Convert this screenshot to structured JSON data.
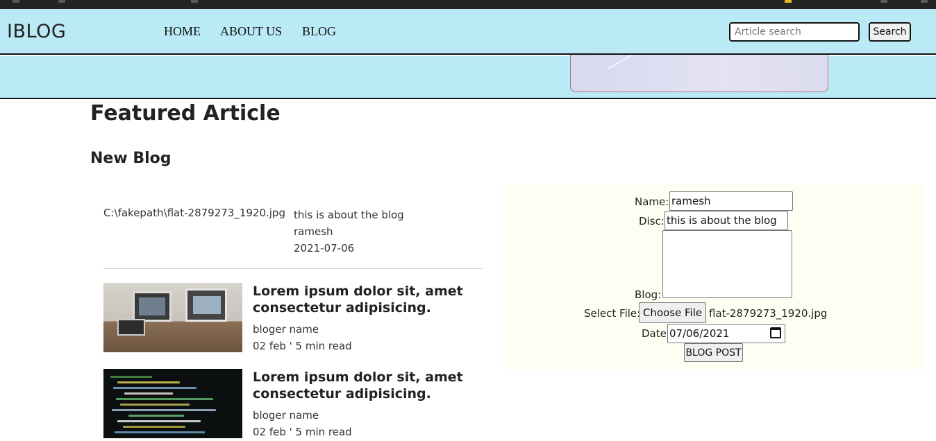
{
  "navbar": {
    "brand": "IBLOG",
    "links": [
      "HOME",
      "ABOUT US",
      "BLOG"
    ],
    "search_placeholder": "Article search",
    "search_button": "Search",
    "background": "#bbeaf7"
  },
  "main": {
    "featured_title": "Featured Article",
    "new_blog_title": "New Blog"
  },
  "new_post": {
    "file_path": "C:\\fakepath\\flat-2879273_1920.jpg",
    "description": "this is about the blog",
    "author": "ramesh",
    "date": "2021-07-06"
  },
  "articles": [
    {
      "title": "Lorem ipsum dolor sit, amet consectetur adipisicing.",
      "author": "bloger name",
      "date": "02 feb ' 5 min read",
      "image_icon": "desk-computers-image"
    },
    {
      "title": "Lorem ipsum dolor sit, amet consectetur adipisicing.",
      "author": "bloger name",
      "date": "02 feb ' 5 min read",
      "image_icon": "code-screen-image"
    }
  ],
  "form": {
    "name_label": "Name:",
    "name_value": "ramesh",
    "disc_label": "Disc:",
    "disc_value": "this is about the blog",
    "blog_label": "Blog:",
    "blog_value": "",
    "file_label": "Select File:",
    "file_button": "Choose File",
    "file_name": "flat-2879273_1920.jpg",
    "date_label": "Date:",
    "date_value": "07/06/2021",
    "submit_label": "BLOG POST",
    "background": "#fefef2"
  }
}
